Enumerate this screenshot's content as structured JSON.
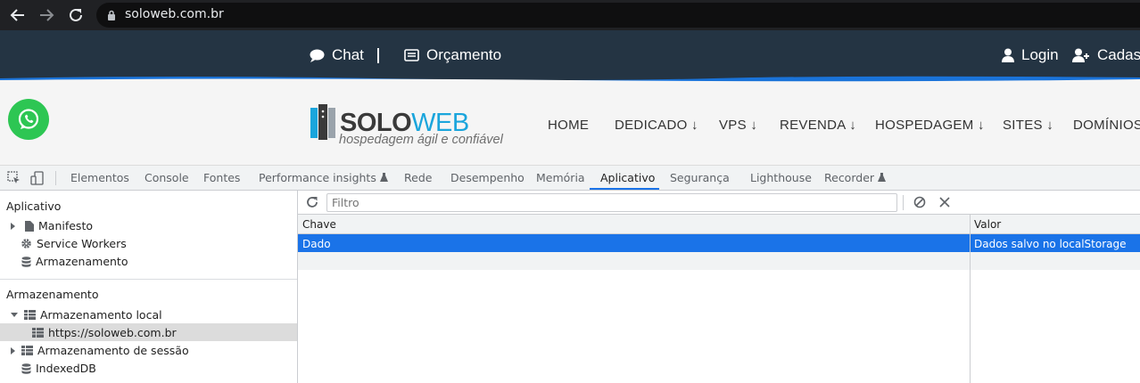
{
  "browser": {
    "url": "soloweb.com.br"
  },
  "site_top": {
    "chat": "Chat",
    "orcamento": "Orçamento",
    "login": "Login",
    "cadastro": "Cadas"
  },
  "site_header": {
    "logo_solo": "SOLO",
    "logo_web": "WEB",
    "tagline": "hospedagem ágil e confiável",
    "nav": [
      "HOME",
      "DEDICADO ↓",
      "VPS ↓",
      "REVENDA ↓",
      "HOSPEDAGEM ↓",
      "SITES ↓",
      "DOMÍNIOS"
    ]
  },
  "devtools": {
    "tabs": [
      "Elementos",
      "Console",
      "Fontes",
      "Performance insights",
      "Rede",
      "Desempenho",
      "Memória",
      "Aplicativo",
      "Segurança",
      "Lighthouse",
      "Recorder"
    ],
    "active_tab": "Aplicativo",
    "sidebar": {
      "section1": "Aplicativo",
      "app_items": [
        "Manifesto",
        "Service Workers",
        "Armazenamento"
      ],
      "section2": "Armazenamento",
      "local_storage": "Armazenamento local",
      "local_origin": "https://soloweb.com.br",
      "session_storage": "Armazenamento de sessão",
      "indexeddb": "IndexedDB"
    },
    "filter_placeholder": "Filtro",
    "grid": {
      "headers": [
        "Chave",
        "Valor"
      ],
      "rows": [
        {
          "key": "Dado",
          "value": "Dados salvo no localStorage"
        }
      ]
    }
  },
  "colors": {
    "accent": "#1a73e8",
    "site_dark": "#243443",
    "logo_blue": "#1aa5dc",
    "whatsapp": "#2dc653"
  }
}
